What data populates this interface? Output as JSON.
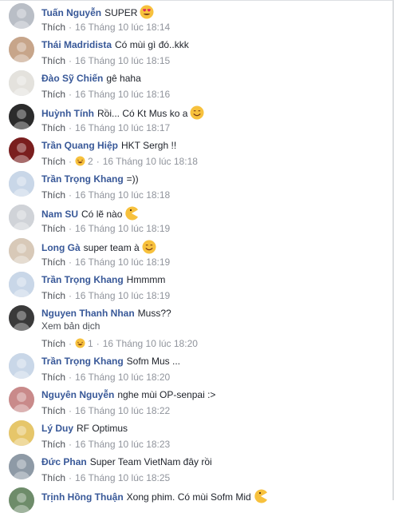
{
  "like_label": "Thích",
  "comments": [
    {
      "name": "Tuấn Nguyễn",
      "text": "SUPER",
      "emoji": "heart-eyes",
      "time": "16 Tháng 10 lúc 18:14",
      "avatar": "#b9bec6"
    },
    {
      "name": "Thái Madridista",
      "text": "Có mùi gì đó..kkk",
      "emoji": "",
      "time": "16 Tháng 10 lúc 18:15",
      "avatar": "#c7a58a"
    },
    {
      "name": "Đào Sỹ Chiến",
      "text": "gê haha",
      "emoji": "",
      "time": "16 Tháng 10 lúc 18:16",
      "avatar": "#e4e2dd"
    },
    {
      "name": "Huỳnh Tính",
      "text": "Rồi... Có Kt Mus ko a",
      "emoji": "smile",
      "time": "16 Tháng 10 lúc 18:17",
      "avatar": "#2b2b2b"
    },
    {
      "name": "Trần Quang Hiệp",
      "text": "HKT Sergh !!",
      "emoji": "",
      "time": "16 Tháng 10 lúc 18:18",
      "reactions": "2",
      "avatar": "#7a1e1e"
    },
    {
      "name": "Trần Trọng Khang",
      "text": "=))",
      "emoji": "",
      "time": "16 Tháng 10 lúc 18:18",
      "avatar": "#c9d7e8"
    },
    {
      "name": "Nam SU",
      "text": "Có lẽ nào",
      "emoji": "pacman",
      "time": "16 Tháng 10 lúc 18:19",
      "avatar": "#d0d3d8"
    },
    {
      "name": "Long Gà",
      "text": "super team à",
      "emoji": "smile",
      "time": "16 Tháng 10 lúc 18:19",
      "avatar": "#d8c9b8"
    },
    {
      "name": "Trần Trọng Khang",
      "text": "Hmmmm",
      "emoji": "",
      "time": "16 Tháng 10 lúc 18:19",
      "avatar": "#c9d7e8"
    },
    {
      "name": "Nguyen Thanh Nhan",
      "text": "Muss??",
      "emoji": "",
      "time": "16 Tháng 10 lúc 18:20",
      "reactions": "1",
      "translation": "Xem bản dịch",
      "avatar": "#3a3a3a"
    },
    {
      "name": "Trần Trọng Khang",
      "text": "Sofm Mus ...",
      "emoji": "",
      "time": "16 Tháng 10 lúc 18:20",
      "avatar": "#c9d7e8"
    },
    {
      "name": "Nguyên Nguyễn",
      "text": "nghe mùi OP-senpai :>",
      "emoji": "",
      "time": "16 Tháng 10 lúc 18:22",
      "avatar": "#c98a8a"
    },
    {
      "name": "Lý Duy",
      "text": "RF Optimus",
      "emoji": "",
      "time": "16 Tháng 10 lúc 18:23",
      "avatar": "#e6c66a"
    },
    {
      "name": "Đức Phan",
      "text": "Super Team VietNam đây rồi",
      "emoji": "",
      "time": "16 Tháng 10 lúc 18:25",
      "avatar": "#8e9aa6"
    },
    {
      "name": "Trịnh Hồng Thuận",
      "text": "Xong phim. Có mùi Sofm Mid",
      "emoji": "pacman",
      "time": "",
      "avatar": "#6e8c6a"
    }
  ]
}
